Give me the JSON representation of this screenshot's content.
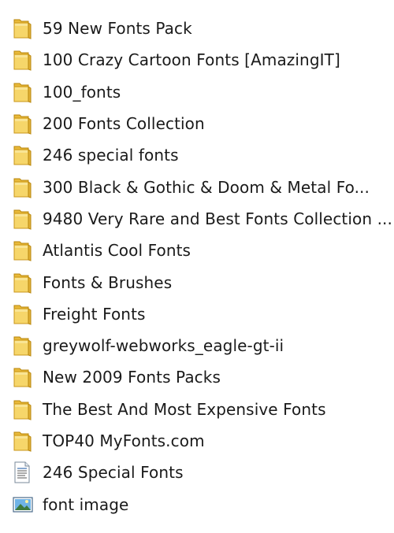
{
  "items": [
    {
      "name": "59 New Fonts Pack",
      "type": "folder",
      "icon": "folder-icon"
    },
    {
      "name": "100 Crazy Cartoon Fonts [AmazingIT]",
      "type": "folder",
      "icon": "folder-icon"
    },
    {
      "name": "100_fonts",
      "type": "folder",
      "icon": "folder-icon"
    },
    {
      "name": "200 Fonts Collection",
      "type": "folder",
      "icon": "folder-icon"
    },
    {
      "name": "246 special fonts",
      "type": "folder",
      "icon": "folder-icon"
    },
    {
      "name": "300 Black & Gothic & Doom & Metal Fo...",
      "type": "folder",
      "icon": "folder-icon"
    },
    {
      "name": "9480 Very Rare and Best Fonts Collection ...",
      "type": "folder",
      "icon": "folder-icon"
    },
    {
      "name": "Atlantis Cool Fonts",
      "type": "folder",
      "icon": "folder-icon"
    },
    {
      "name": "Fonts & Brushes",
      "type": "folder",
      "icon": "folder-icon"
    },
    {
      "name": "Freight Fonts",
      "type": "folder",
      "icon": "folder-icon"
    },
    {
      "name": "greywolf-webworks_eagle-gt-ii",
      "type": "folder",
      "icon": "folder-icon"
    },
    {
      "name": "New 2009 Fonts Packs",
      "type": "folder",
      "icon": "folder-icon"
    },
    {
      "name": "The Best And Most Expensive Fonts",
      "type": "folder",
      "icon": "folder-icon"
    },
    {
      "name": "TOP40 MyFonts.com",
      "type": "folder",
      "icon": "folder-icon"
    },
    {
      "name": "246 Special Fonts",
      "type": "document",
      "icon": "text-document-icon"
    },
    {
      "name": "font image",
      "type": "image",
      "icon": "image-file-icon"
    }
  ],
  "colors": {
    "folder_body": "#f2c94c",
    "folder_front": "#f7d96b",
    "folder_edge": "#c9961a",
    "text": "#1a1a1a"
  }
}
